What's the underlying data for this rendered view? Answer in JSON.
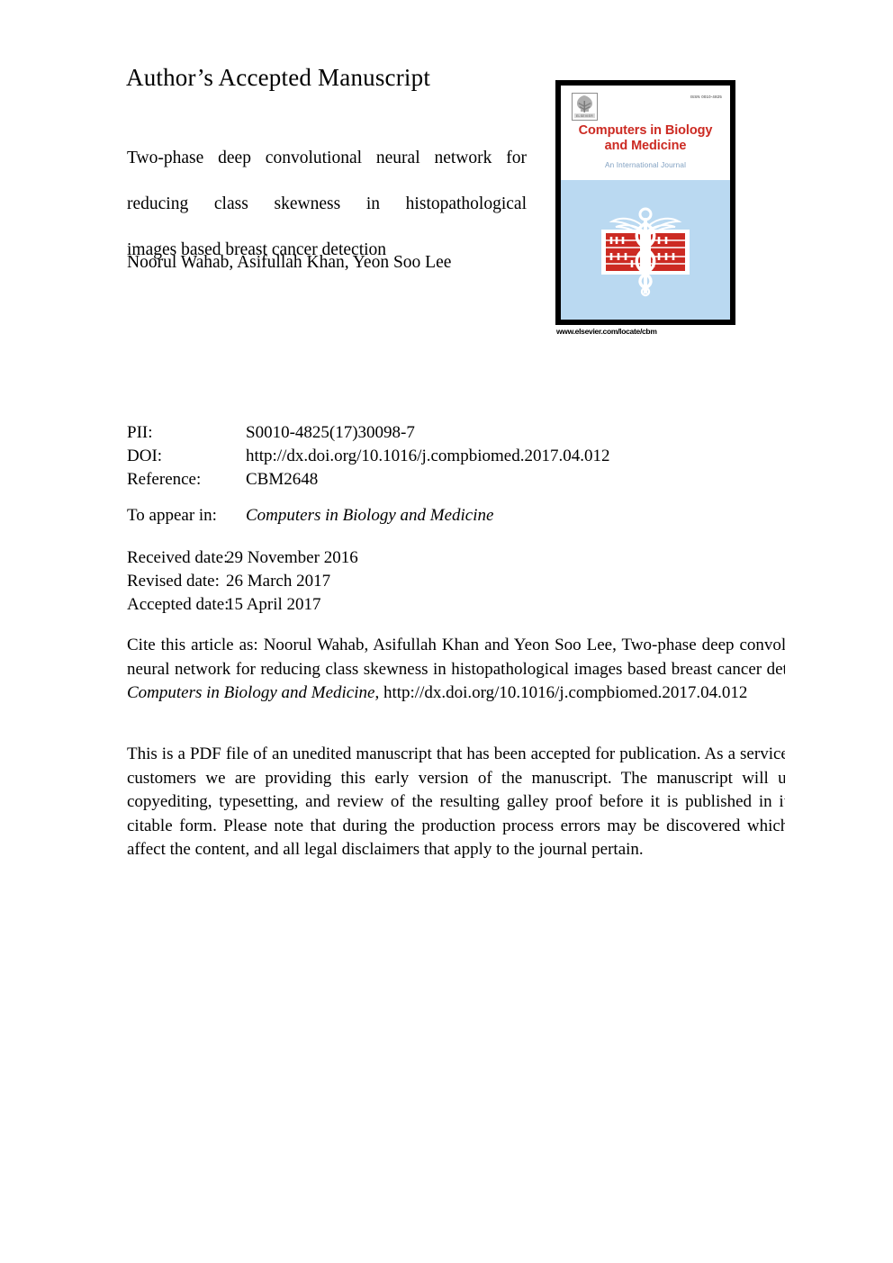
{
  "header": {
    "aam_heading": "Author’s Accepted Manuscript"
  },
  "article": {
    "title_line1": "Two-phase deep convolutional neural network for",
    "title_line2": "reducing class skewness in histopathological",
    "title_line3": "images based breast cancer detection",
    "authors": "Noorul Wahab, Asifullah Khan, Yeon Soo Lee"
  },
  "cover": {
    "publisher_logo_name": "elsevier-tree-logo",
    "issn": "ISSN 0010-4825",
    "journal_title_line1": "Computers in Biology",
    "journal_title_line2": "and Medicine",
    "subtitle": "An International Journal",
    "emblem_name": "caduceus-abacus-emblem",
    "url": "www.elsevier.com/locate/cbm",
    "colors": {
      "title_red": "#cc2a22",
      "subtitle_blue": "#7f9fc0",
      "panel_blue": "#bad9f1",
      "border_black": "#000000"
    }
  },
  "metadata": {
    "rows": [
      {
        "label": "PII:",
        "value": "S0010-4825(17)30098-7"
      },
      {
        "label": "DOI:",
        "value": "http://dx.doi.org/10.1016/j.compbiomed.2017.04.012"
      },
      {
        "label": "Reference:",
        "value": "CBM2648"
      }
    ],
    "appear_label": "To appear in:",
    "appear_value": "Computers in Biology and Medicine",
    "dates": [
      {
        "label": "Received date:",
        "value": "29 November 2016"
      },
      {
        "label": "Revised date:",
        "value": "26 March 2017"
      },
      {
        "label": "Accepted date:",
        "value": "15 April 2017"
      }
    ]
  },
  "citation": {
    "prefix": "Cite this article as: Noorul Wahab, Asifullah Khan and Yeon Soo Lee, Two-phase deep convolutional neural network for reducing class skewness in histopathological images based breast cancer detection, ",
    "journal_italic": "Computers in Biology and Medicine",
    "suffix": ", http://dx.doi.org/10.1016/j.compbiomed.2017.04.012"
  },
  "disclaimer": {
    "text": "This is a PDF file of an unedited manuscript that has been accepted for publication. As a service to our customers we are providing this early version of the manuscript. The manuscript will undergo copyediting, typesetting, and review of the resulting galley proof before it is published in its final citable form. Please note that during the production process errors may be discovered which could affect the content, and all legal disclaimers that apply to the journal pertain."
  }
}
